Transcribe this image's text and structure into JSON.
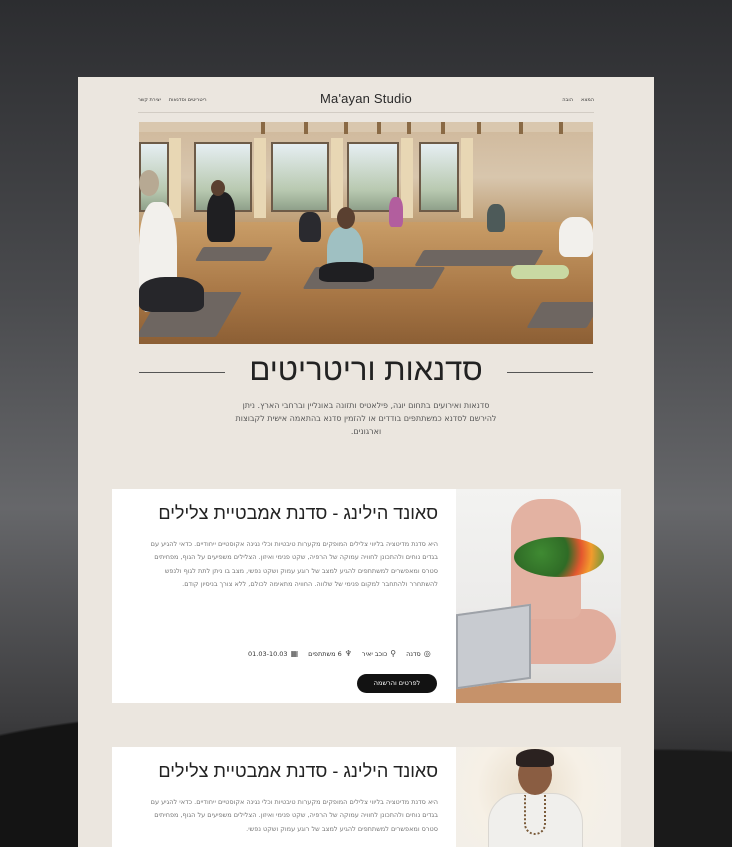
{
  "header": {
    "brand": "Ma'ayan Studio",
    "nav_left": [
      "יצירת קשר",
      "ריטריטים וסדנאות"
    ],
    "nav_right": [
      "המצא",
      "הובה"
    ]
  },
  "hero": {
    "image_alt": "yoga-studio-class"
  },
  "page_title": "סדנאות וריטריטים",
  "intro": "סדנאות ואירועים בתחום יוגה, פילאטיס ותזונה באונליין וברחבי הארץ. ניתן להירשם לסדנא כמשתתפים בודדים או להזמין סדנא בהתאמה אישית לקבוצות וארגונים.",
  "cards": [
    {
      "title": "סאונד הילינג - סדנת אמבטיית צלילים",
      "description": "היא סדנת מדיטציה בליווי צלילים המופקים מקערות טיבטיות וכלי נגינה אקוסטיים ייחודיים. כדאי להגיע עם בגדים נוחים ולהתכונן לחוויה עמוקה של הרפיה, שקט פנימי ואיזון. הצלילים משפיעים על הגוף, מפחיתים סטרס ומאפשרים למשתתפים להגיע למצב של רוגע עמוק ושקט נפשי, מצב בו ניתן לתת לגוף ולנפש להשתחרר ולהתחבר למקום פנימי של שלווה. החוויה מתאימה לכולם, ללא צורך בניסיון קודם.",
      "meta": {
        "location": "סדנה",
        "place": "כוכב יאיר",
        "participants": "6 משתתפים",
        "dates": "01.03-10.03"
      },
      "cta": "לפרטים והרשמה"
    },
    {
      "title": "סאונד הילינג - סדנת אמבטיית צלילים",
      "description": "היא סדנת מדיטציה בליווי צלילים המופקים מקערות טיבטיות וכלי נגינה אקוסטיים ייחודיים. כדאי להגיע עם בגדים נוחים ולהתכונן לחוויה עמוקה של הרפיה, שקט פנימי ואיזון. הצלילים משפיעים על הגוף, מפחיתים סטרס ומאפשרים למשתתפים להגיע למצב של רוגע עמוק ושקט נפשי."
    }
  ]
}
